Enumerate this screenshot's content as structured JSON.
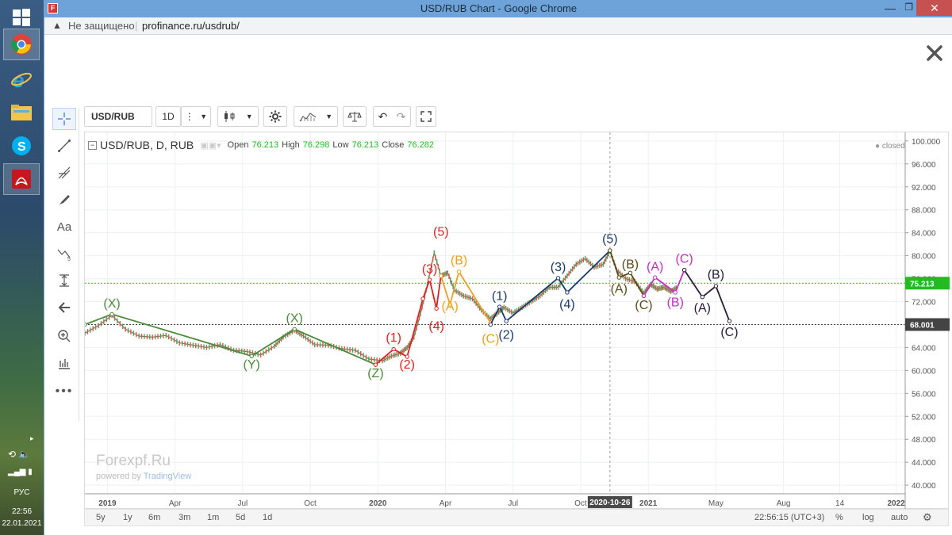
{
  "window": {
    "title": "USD/RUB Chart - Google Chrome"
  },
  "address": {
    "security": "Не защищено",
    "url": "profinance.ru/usdrub/"
  },
  "taskbar": {
    "lang": "РУС",
    "time": "22:56",
    "date": "22.01.2021"
  },
  "toolbar": {
    "symbol": "USD/RUB",
    "interval": "1D"
  },
  "legend": {
    "title": "USD/RUB, D, RUB",
    "open_label": "Open",
    "open": "76.213",
    "high_label": "High",
    "high": "76.298",
    "low_label": "Low",
    "low": "76.213",
    "close_label": "Close",
    "close": "76.282",
    "status": "closed"
  },
  "watermark": {
    "brand": "Forexpf.Ru",
    "powered": "powered by",
    "tv": "TradingView"
  },
  "bottom": {
    "ranges": [
      "5y",
      "1y",
      "6m",
      "3m",
      "1m",
      "5d",
      "1d"
    ],
    "clock": "22:56:15 (UTC+3)",
    "pct": "%",
    "log": "log",
    "auto": "auto"
  },
  "chart_data": {
    "type": "line",
    "price_ticks": [
      "100.000",
      "96.000",
      "92.000",
      "88.000",
      "84.000",
      "80.000",
      "76.000",
      "72.000",
      "68.000",
      "64.000",
      "60.000",
      "56.000",
      "52.000",
      "48.000",
      "44.000",
      "40.000"
    ],
    "price_range": [
      38.5,
      101.5
    ],
    "price_badges": [
      {
        "value": 75.213,
        "label": "75.213",
        "color": "#22bb22"
      },
      {
        "value": 68.001,
        "label": "68.001",
        "color": "#444444"
      }
    ],
    "time_labels": [
      {
        "t": 1.0,
        "label": "2019"
      },
      {
        "t": 4.0,
        "label": "Apr"
      },
      {
        "t": 7.0,
        "label": "Jul"
      },
      {
        "t": 10.0,
        "label": "Oct"
      },
      {
        "t": 13.0,
        "label": "2020"
      },
      {
        "t": 16.0,
        "label": "Apr"
      },
      {
        "t": 19.0,
        "label": "Jul"
      },
      {
        "t": 22.0,
        "label": "Oct"
      },
      {
        "t": 25.0,
        "label": "2021"
      },
      {
        "t": 28.0,
        "label": "May"
      },
      {
        "t": 31.0,
        "label": "Aug"
      },
      {
        "t": 33.5,
        "label": "14"
      },
      {
        "t": 36.0,
        "label": "2022"
      }
    ],
    "time_range": [
      0,
      36.4
    ],
    "crosshair": {
      "t": 23.3,
      "label": "2020-10-26"
    },
    "price_series": [
      [
        0,
        66.5
      ],
      [
        0.6,
        67.8
      ],
      [
        1.2,
        69.6
      ],
      [
        1.8,
        67.2
      ],
      [
        2.4,
        66.0
      ],
      [
        3.0,
        65.8
      ],
      [
        3.6,
        66.1
      ],
      [
        4.2,
        64.8
      ],
      [
        4.8,
        64.4
      ],
      [
        5.4,
        64.0
      ],
      [
        6.0,
        64.5
      ],
      [
        6.6,
        63.5
      ],
      [
        7.2,
        63.3
      ],
      [
        7.8,
        62.7
      ],
      [
        8.4,
        64.2
      ],
      [
        8.8,
        65.8
      ],
      [
        9.3,
        67.0
      ],
      [
        9.7,
        66.0
      ],
      [
        10.2,
        64.5
      ],
      [
        10.8,
        64.4
      ],
      [
        11.4,
        63.8
      ],
      [
        12.0,
        63.5
      ],
      [
        12.6,
        62.0
      ],
      [
        13.2,
        61.7
      ],
      [
        13.6,
        62.5
      ],
      [
        14.0,
        63.0
      ],
      [
        14.3,
        64.0
      ],
      [
        14.6,
        65.8
      ],
      [
        14.9,
        70.0
      ],
      [
        15.2,
        75.0
      ],
      [
        15.5,
        80.5
      ],
      [
        15.8,
        76.5
      ],
      [
        16.1,
        77.0
      ],
      [
        16.4,
        74.0
      ],
      [
        16.8,
        73.0
      ],
      [
        17.2,
        72.5
      ],
      [
        17.6,
        70.5
      ],
      [
        18.0,
        69.0
      ],
      [
        18.3,
        70.0
      ],
      [
        18.6,
        71.0
      ],
      [
        19.0,
        70.0
      ],
      [
        19.4,
        71.0
      ],
      [
        19.8,
        72.0
      ],
      [
        20.2,
        73.0
      ],
      [
        20.6,
        74.5
      ],
      [
        21.0,
        74.5
      ],
      [
        21.4,
        76.5
      ],
      [
        21.8,
        78.5
      ],
      [
        22.2,
        79.5
      ],
      [
        22.6,
        78.0
      ],
      [
        23.0,
        78.5
      ],
      [
        23.3,
        80.8
      ],
      [
        23.6,
        77.5
      ],
      [
        24.0,
        76.0
      ],
      [
        24.4,
        75.5
      ],
      [
        24.8,
        73.5
      ],
      [
        25.1,
        75.0
      ],
      [
        25.4,
        74.2
      ],
      [
        25.7,
        74.5
      ],
      [
        26.0,
        73.8
      ],
      [
        26.3,
        74.5
      ]
    ],
    "waves": [
      {
        "color": "#4a8a3a",
        "points": [
          [
            0,
            68.0
          ],
          [
            1.2,
            69.8
          ],
          [
            7.4,
            62.5
          ],
          [
            9.3,
            67.2
          ],
          [
            12.9,
            61.0
          ]
        ]
      },
      {
        "color": "#e02020",
        "points": [
          [
            12.9,
            61.0
          ],
          [
            13.7,
            63.7
          ],
          [
            14.3,
            62.4
          ],
          [
            15.0,
            72.5
          ],
          [
            15.3,
            75.8
          ],
          [
            15.6,
            70.8
          ],
          [
            15.8,
            76.5
          ]
        ]
      },
      {
        "color": "#f0a020",
        "points": [
          [
            15.8,
            76.5
          ],
          [
            16.2,
            71.5
          ],
          [
            16.6,
            77.2
          ],
          [
            18.0,
            68.3
          ]
        ]
      },
      {
        "color": "#1b3a6b",
        "points": [
          [
            18.0,
            68.0
          ],
          [
            18.4,
            71.1
          ],
          [
            18.7,
            68.6
          ],
          [
            21.0,
            76.1
          ],
          [
            21.4,
            73.6
          ],
          [
            23.3,
            80.9
          ]
        ]
      },
      {
        "color": "#5a4a1a",
        "points": [
          [
            23.3,
            80.9
          ],
          [
            23.7,
            76.2
          ],
          [
            24.2,
            77.0
          ],
          [
            24.8,
            73.0
          ]
        ]
      },
      {
        "color": "#c030c0",
        "points": [
          [
            24.8,
            73.0
          ],
          [
            25.3,
            76.2
          ],
          [
            26.2,
            73.6
          ],
          [
            26.6,
            77.5
          ]
        ]
      },
      {
        "color": "#2a1a3a",
        "points": [
          [
            26.6,
            77.5
          ],
          [
            27.4,
            72.8
          ],
          [
            28.0,
            74.7
          ],
          [
            28.6,
            68.6
          ]
        ]
      }
    ],
    "labels": [
      {
        "t": 1.2,
        "p": 71.0,
        "text": "(X)",
        "color": "#4a8a3a"
      },
      {
        "t": 7.4,
        "p": 60.3,
        "text": "(Y)",
        "color": "#4a8a3a"
      },
      {
        "t": 9.3,
        "p": 68.4,
        "text": "(X)",
        "color": "#4a8a3a"
      },
      {
        "t": 12.9,
        "p": 58.8,
        "text": "(Z)",
        "color": "#4a8a3a"
      },
      {
        "t": 13.7,
        "p": 65.0,
        "text": "(1)",
        "color": "#e02020"
      },
      {
        "t": 14.3,
        "p": 60.3,
        "text": "(2)",
        "color": "#e02020"
      },
      {
        "t": 15.3,
        "p": 77.0,
        "text": "(3)",
        "color": "#e02020"
      },
      {
        "t": 15.6,
        "p": 67.0,
        "text": "(4)",
        "color": "#e02020"
      },
      {
        "t": 15.8,
        "p": 83.5,
        "text": "(5)",
        "color": "#e02020"
      },
      {
        "t": 16.6,
        "p": 78.5,
        "text": "(B)",
        "color": "#f0a020"
      },
      {
        "t": 16.2,
        "p": 70.5,
        "text": "(A)",
        "color": "#f0a020"
      },
      {
        "t": 18.0,
        "p": 64.8,
        "text": "(C)",
        "color": "#f0a020"
      },
      {
        "t": 18.4,
        "p": 72.3,
        "text": "(1)",
        "color": "#1b3a6b"
      },
      {
        "t": 18.7,
        "p": 65.5,
        "text": "(2)",
        "color": "#1b3a6b"
      },
      {
        "t": 21.0,
        "p": 77.3,
        "text": "(3)",
        "color": "#1b3a6b"
      },
      {
        "t": 21.4,
        "p": 70.8,
        "text": "(4)",
        "color": "#1b3a6b"
      },
      {
        "t": 23.3,
        "p": 82.2,
        "text": "(5)",
        "color": "#1b3a6b"
      },
      {
        "t": 24.2,
        "p": 77.8,
        "text": "(B)",
        "color": "#5a4a1a"
      },
      {
        "t": 23.7,
        "p": 73.5,
        "text": "(A)",
        "color": "#5a4a1a"
      },
      {
        "t": 24.8,
        "p": 70.7,
        "text": "(C)",
        "color": "#5a4a1a"
      },
      {
        "t": 25.3,
        "p": 77.4,
        "text": "(A)",
        "color": "#c030c0"
      },
      {
        "t": 26.2,
        "p": 71.2,
        "text": "(B)",
        "color": "#c030c0"
      },
      {
        "t": 26.6,
        "p": 78.8,
        "text": "(C)",
        "color": "#c030c0"
      },
      {
        "t": 27.4,
        "p": 70.2,
        "text": "(A)",
        "color": "#2a1a3a"
      },
      {
        "t": 28.0,
        "p": 76.0,
        "text": "(B)",
        "color": "#2a1a3a"
      },
      {
        "t": 28.6,
        "p": 66.0,
        "text": "(C)",
        "color": "#2a1a3a"
      }
    ]
  }
}
